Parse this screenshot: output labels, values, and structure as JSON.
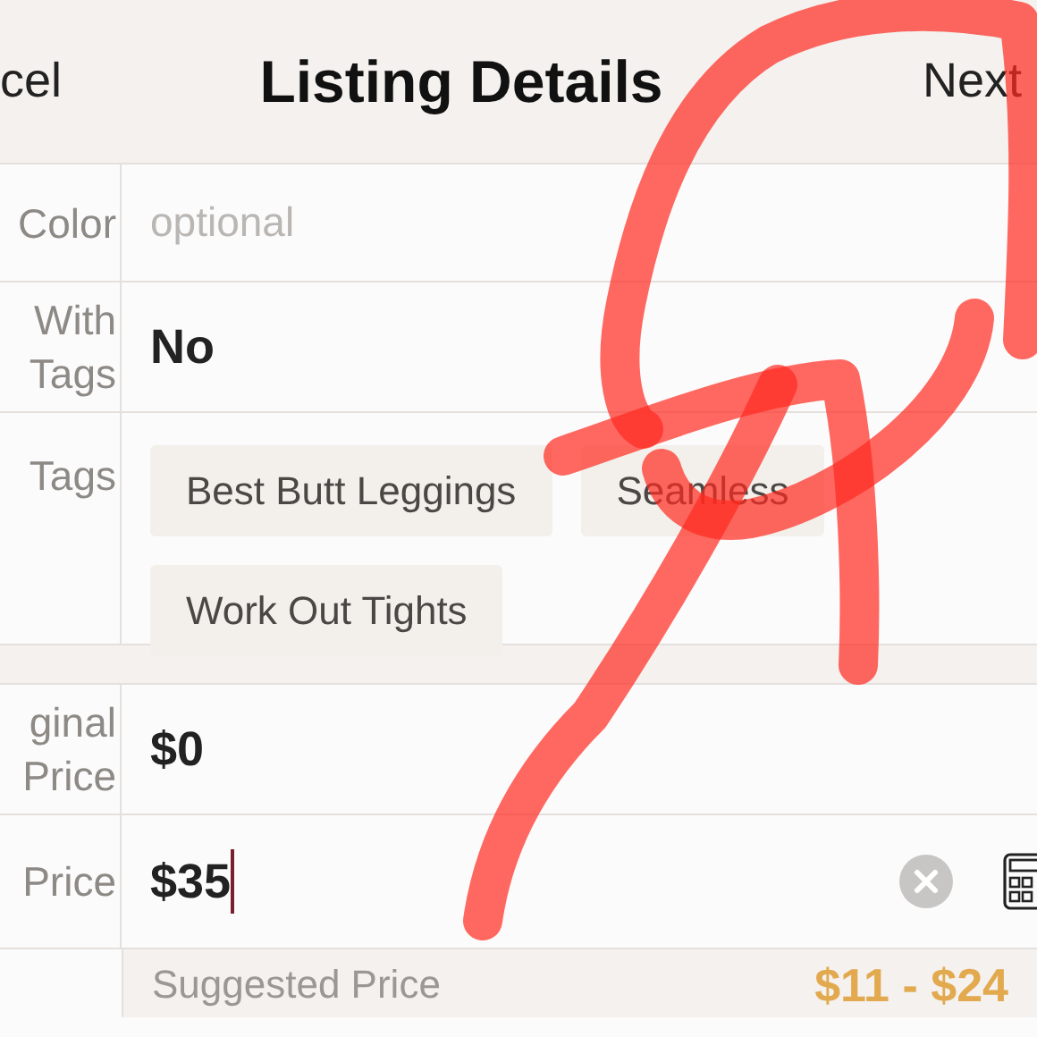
{
  "header": {
    "cancel": "cel",
    "title": "Listing Details",
    "next": "Next"
  },
  "sections": [
    [
      {
        "kind": "text",
        "label_lines": [
          "Color"
        ],
        "placeholder": "optional"
      },
      {
        "kind": "text",
        "label_lines": [
          "With",
          "Tags"
        ],
        "value": "No"
      },
      {
        "kind": "tags",
        "label_lines": [
          "Tags"
        ],
        "tags": [
          "Best Butt Leggings",
          "Seamless",
          "Work Out Tights"
        ]
      }
    ],
    [
      {
        "kind": "text",
        "label_lines": [
          "ginal",
          "Price"
        ],
        "value": "$0"
      },
      {
        "kind": "price",
        "label_lines": [
          "Price"
        ],
        "value": "$35"
      }
    ]
  ],
  "suggested": {
    "label": "Suggested Price",
    "range": "$11 - $24"
  }
}
